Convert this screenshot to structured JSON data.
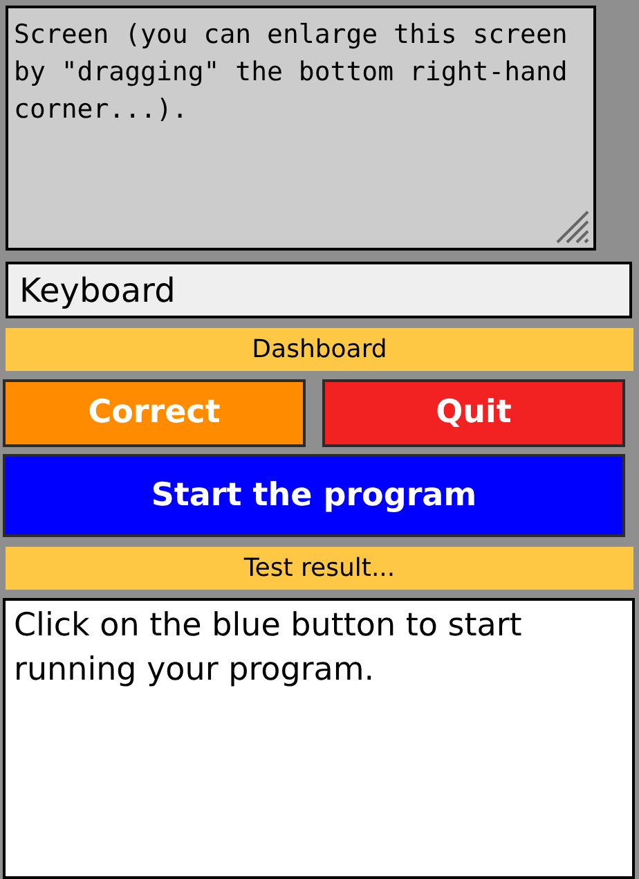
{
  "screen": {
    "text": "Screen (you can enlarge this screen by \"dragging\" the bottom right-hand corner...)."
  },
  "keyboard": {
    "value": "Keyboard"
  },
  "dashboard": {
    "title": "Dashboard"
  },
  "controls": [
    {
      "label": "Correct",
      "color": "#ff8c00"
    },
    {
      "label": "Quit",
      "color": "#f22222"
    }
  ],
  "start_button": {
    "label": "Start the program",
    "color": "#0000ff"
  },
  "result": {
    "title": "Test result...",
    "text": "Click on the blue button to start running your program."
  }
}
